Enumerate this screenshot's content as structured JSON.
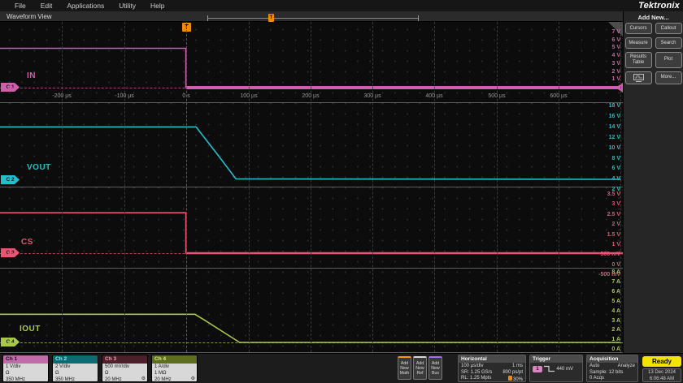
{
  "menu": {
    "items": [
      "File",
      "Edit",
      "Applications",
      "Utility",
      "Help"
    ]
  },
  "brand": "Tektronix",
  "tab": {
    "label": "Waveform View"
  },
  "sidebar": {
    "title": "Add New...",
    "buttons": [
      "Cursors",
      "Callout",
      "Measure",
      "Search",
      "Results Table",
      "Plot"
    ],
    "more_label": "More..."
  },
  "waveform": {
    "trigger_flag": "T",
    "time_labels": [
      "-200 µs",
      "-100 µs",
      "0 s",
      "100 µs",
      "200 µs",
      "300 µs",
      "400 µs",
      "500 µs",
      "600 µs"
    ],
    "channels": [
      {
        "id": "C 1",
        "name": "IN",
        "color": "#cf5fae",
        "scale_labels": [
          "7 V",
          "6 V",
          "5 V",
          "4 V",
          "3 V",
          "2 V",
          "1 V"
        ]
      },
      {
        "id": "C 2",
        "name": "VOUT",
        "color": "#1fc0cc",
        "scale_labels": [
          "18 V",
          "16 V",
          "14 V",
          "12 V",
          "10 V",
          "8 V",
          "6 V",
          "4 V",
          "2 V"
        ]
      },
      {
        "id": "C 3",
        "name": "CS",
        "color": "#ea5472",
        "scale_labels": [
          "3.5 V",
          "3 V",
          "2.5 V",
          "2 V",
          "1.5 V",
          "1 V",
          "500 mV",
          "0 V",
          "-500 mV"
        ]
      },
      {
        "id": "C 4",
        "name": "IOUT",
        "color": "#a8c84a",
        "scale_labels": [
          "8 A",
          "7 A",
          "6 A",
          "5 A",
          "4 A",
          "3 A",
          "2 A",
          "1 A",
          "0 A"
        ]
      }
    ]
  },
  "chart_data": {
    "type": "line",
    "xlabel": "time",
    "x_units": "µs",
    "x_range": [
      -300,
      700
    ],
    "horizontal_scale": "100 µs/div",
    "trigger_time": 0,
    "series": [
      {
        "name": "IN",
        "unit": "V",
        "color": "#cf5fae",
        "scale": "1 V/div",
        "points": [
          [
            -300,
            5
          ],
          [
            -0.5,
            5
          ],
          [
            -0.5,
            0
          ],
          [
            700,
            0
          ]
        ]
      },
      {
        "name": "VOUT",
        "unit": "V",
        "color": "#1fc0cc",
        "scale": "2 V/div",
        "points": [
          [
            -300,
            13.4
          ],
          [
            16,
            13.4
          ],
          [
            23,
            12.3
          ],
          [
            50,
            8.2
          ],
          [
            80,
            3.5
          ],
          [
            700,
            3.4
          ]
        ]
      },
      {
        "name": "CS",
        "unit": "V",
        "color": "#ea5472",
        "scale": "500 mV/div",
        "points": [
          [
            -300,
            2
          ],
          [
            -0.5,
            2
          ],
          [
            -0.5,
            0
          ],
          [
            700,
            0
          ]
        ]
      },
      {
        "name": "IOUT",
        "unit": "A",
        "color": "#a8c84a",
        "scale": "1 A/div",
        "points": [
          [
            -300,
            2.8
          ],
          [
            14,
            2.8
          ],
          [
            30,
            2.2
          ],
          [
            86,
            0
          ],
          [
            700,
            0
          ]
        ]
      }
    ]
  },
  "bottom": {
    "channel_badges": [
      {
        "label": "Ch 1",
        "scale": "1 V/div",
        "coupling": "Ω",
        "bandwidth": "350 MHz",
        "probe": false,
        "hdr_bg": "#c06ca8",
        "hdr_fg": "#20081a"
      },
      {
        "label": "Ch 2",
        "scale": "2 V/div",
        "coupling": "Ω",
        "bandwidth": "350 MHz",
        "probe": false,
        "hdr_bg": "#0d6b74",
        "hdr_fg": "#8deaf0"
      },
      {
        "label": "Ch 3",
        "scale": "500 mV/div",
        "coupling": "Ω",
        "bandwidth": "20 MHz",
        "probe": true,
        "hdr_bg": "#4d1f2a",
        "hdr_fg": "#eda4b4"
      },
      {
        "label": "Ch 4",
        "scale": "1 A/div",
        "coupling": "1 MΩ",
        "bandwidth": "20 MHz",
        "probe": true,
        "hdr_bg": "#5f6d1f",
        "hdr_fg": "#dcef86"
      }
    ],
    "add_buttons": [
      {
        "label": "Add New Math",
        "accent": "#ff9a00"
      },
      {
        "label": "Add New Ref",
        "accent": "#d8d8d8"
      },
      {
        "label": "Add New Bus",
        "accent": "#a96bff"
      }
    ],
    "horizontal": {
      "title": "Horizontal",
      "scale": "100 µs/div",
      "window": "1 ms",
      "sr": "SR: 1.25 GS/s",
      "res": "800 ps/pt",
      "rl": "RL: 1.25 Mpts",
      "pos": "30%"
    },
    "trigger": {
      "title": "Trigger",
      "source": "1",
      "level": "440 mV"
    },
    "acquisition": {
      "title": "Acquisition",
      "mode": "Auto",
      "analyze": "Analyze",
      "sample": "Sample: 12 bits",
      "acqs": "0 Acqs"
    },
    "status": {
      "ready": "Ready",
      "date": "13 Dec 2024",
      "time": "6:06:48 AM"
    }
  }
}
